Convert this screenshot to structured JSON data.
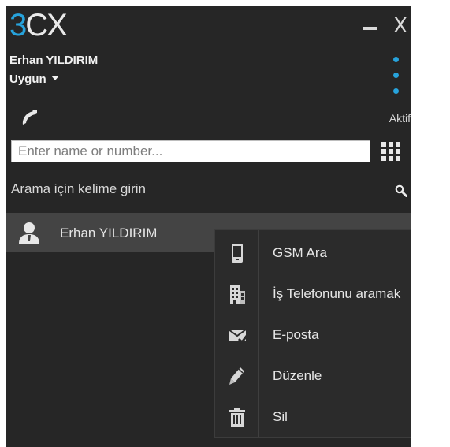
{
  "app": {
    "logo": {
      "part1": "3",
      "part2": "CX"
    },
    "window_controls": {
      "minimize": "minimize",
      "close": "X"
    }
  },
  "user": {
    "name": "Erhan YILDIRIM",
    "status": "Uygun"
  },
  "status_indicator": "Aktif",
  "search": {
    "placeholder": "Enter name or number...",
    "value": ""
  },
  "directory": {
    "hint": "Arama için kelime girin"
  },
  "contacts": [
    {
      "name": "Erhan YILDIRIM"
    }
  ],
  "context_menu": {
    "items": [
      {
        "label": "GSM Ara",
        "icon": "mobile-phone-icon"
      },
      {
        "label": "İş Telefonunu aramak",
        "icon": "office-building-icon"
      },
      {
        "label": "E-posta",
        "icon": "envelope-icon"
      },
      {
        "label": "Düzenle",
        "icon": "pencil-icon"
      },
      {
        "label": "Sil",
        "icon": "trash-icon"
      }
    ]
  },
  "colors": {
    "accent": "#27a3dc",
    "window_bg": "#262626",
    "row_bg": "#444444",
    "menu_bg": "#2b2b2b"
  }
}
